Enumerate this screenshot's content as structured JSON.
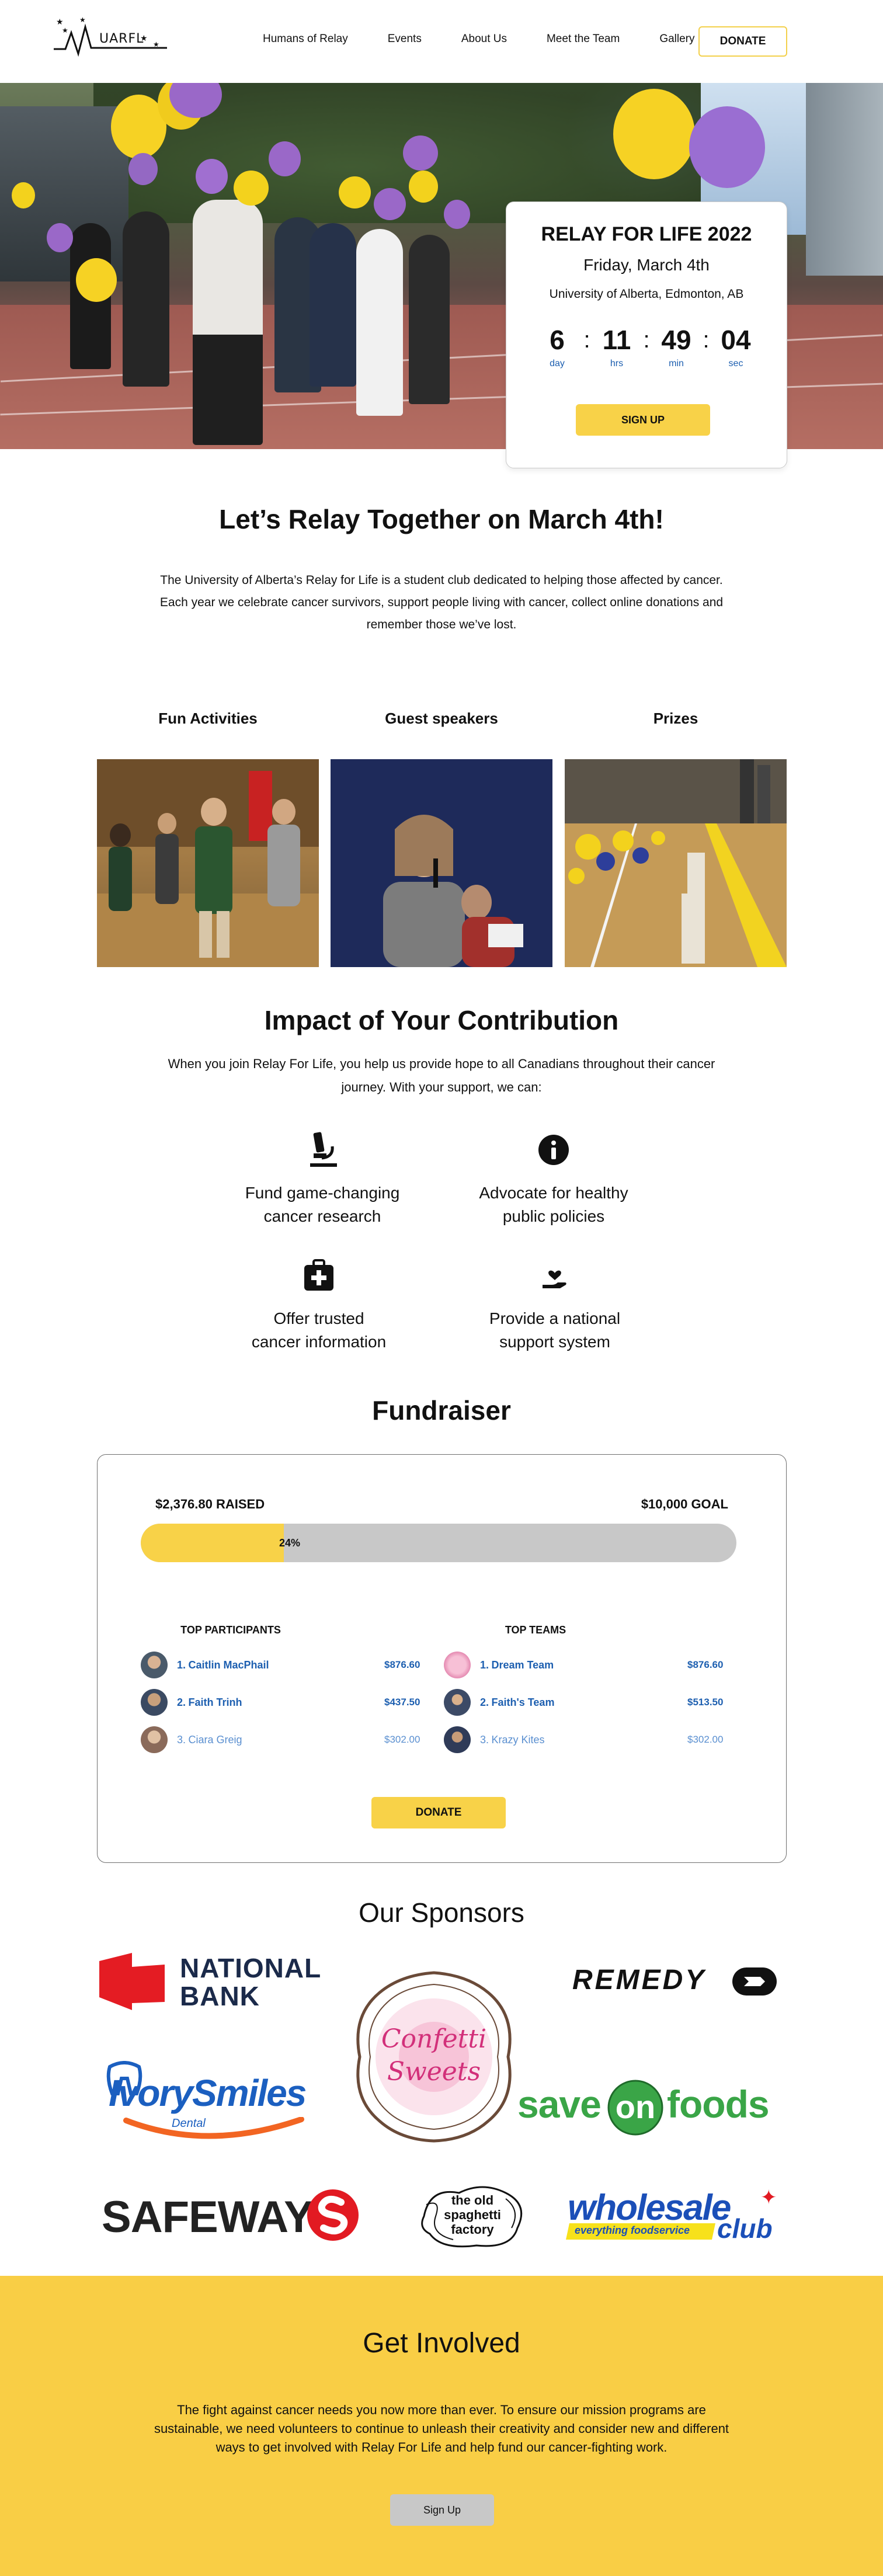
{
  "nav": {
    "logo_text": "UARFL",
    "links": [
      "Humans of Relay",
      "Events",
      "About Us",
      "Meet the Team",
      "Gallery"
    ],
    "donate_label": "DONATE"
  },
  "hero": {
    "card": {
      "title": "RELAY FOR LIFE 2022",
      "date": "Friday, March 4th",
      "location": "University of Alberta, Edmonton, AB",
      "countdown": [
        {
          "value": "6",
          "unit": "day"
        },
        {
          "value": "11",
          "unit": "hrs"
        },
        {
          "value": "49",
          "unit": "min"
        },
        {
          "value": "04",
          "unit": "sec"
        }
      ],
      "signup_label": "SIGN UP"
    }
  },
  "intro": {
    "title": "Let’s Relay Together on March 4th!",
    "text": "The University of Alberta’s Relay for Life is a student club dedicated to helping those affected by cancer. Each year we celebrate cancer survivors, support people living with cancer, collect online donations and remember those we’ve lost."
  },
  "features": [
    {
      "label": "Fun Activities"
    },
    {
      "label": "Guest speakers"
    },
    {
      "label": "Prizes"
    }
  ],
  "impact": {
    "title": "Impact of Your Contribution",
    "text": "When you join Relay For Life, you help us provide hope to all Canadians throughout their cancer journey. With your support, we can:",
    "items": [
      {
        "line1": "Fund game-changing",
        "line2": "cancer research",
        "icon": "microscope-icon"
      },
      {
        "line1": "Advocate for healthy",
        "line2": "public policies",
        "icon": "info-icon"
      },
      {
        "line1": "Offer trusted",
        "line2": "cancer information",
        "icon": "medical-kit-icon"
      },
      {
        "line1": "Provide a national",
        "line2": "support system",
        "icon": "hand-heart-icon"
      }
    ]
  },
  "fundraiser": {
    "title": "Fundraiser",
    "raised": "$2,376.80 RAISED",
    "goal": "$10,000 GOAL",
    "progress_label": "24%",
    "progress_fraction": 0.24,
    "top_participants_label": "TOP PARTICIPANTS",
    "top_teams_label": "TOP TEAMS",
    "participants": [
      {
        "rank": "1.",
        "name": "Caitlin MacPhail",
        "amount": "$876.60"
      },
      {
        "rank": "2.",
        "name": "Faith Trinh",
        "amount": "$437.50"
      },
      {
        "rank": "3.",
        "name": "Ciara Greig",
        "amount": "$302.00"
      }
    ],
    "teams": [
      {
        "rank": "1.",
        "name": "Dream Team",
        "amount": "$876.60"
      },
      {
        "rank": "2.",
        "name": "Faith's Team",
        "amount": "$513.50"
      },
      {
        "rank": "3.",
        "name": "Krazy Kites",
        "amount": "$302.00"
      }
    ],
    "donate_label": "DONATE"
  },
  "sponsors": {
    "title": "Our Sponsors",
    "logos": {
      "national_bank": [
        "NATIONAL",
        "BANK"
      ],
      "remedy": "REMEDY",
      "confetti": [
        "Confetti",
        "Sweets"
      ],
      "ivory": [
        "IvorySmiles",
        "Dental"
      ],
      "saveonfoods": [
        "save",
        "on",
        "foods"
      ],
      "safeway": "SAFEWAY",
      "spaghetti": [
        "the old",
        "spaghetti",
        "factory"
      ],
      "wholesale": [
        "wholesale",
        "club",
        "everything foodservice"
      ]
    }
  },
  "involved": {
    "title": "Get Involved",
    "text": "The fight against cancer needs you now more than ever. To ensure our mission programs are sustainable, we need volunteers to continue to unleash their creativity and consider new and different ways to get involved with Relay For Life and help fund our cancer-fighting work.",
    "signup_label": "Sign Up"
  },
  "colors": {
    "accent_yellow": "#f8d248",
    "link_blue": "#1d5fb0",
    "involved_bg": "#f9ce45"
  }
}
